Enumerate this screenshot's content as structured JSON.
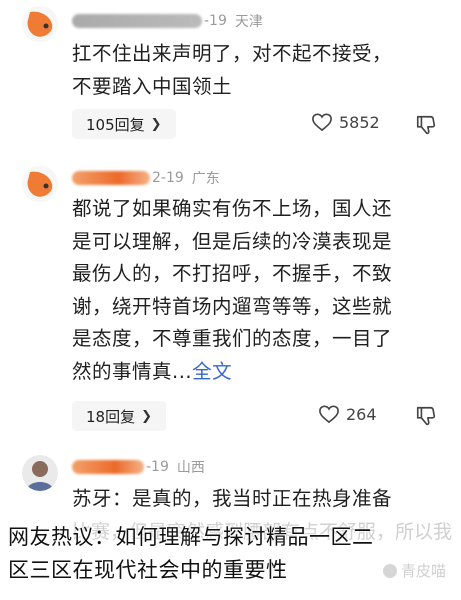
{
  "comments": [
    {
      "date_fragment": "-19",
      "location": "天津",
      "text": "扛不住出来声明了，对不起不接受，\n不要踏入中国领土",
      "reply_label": "105回复",
      "likes": "5852"
    },
    {
      "date_fragment": "2-19",
      "location": "广东",
      "text": "都说了如果确实有伤不上场，国人还\n是可以理解，但是后续的冷漠表现是\n最伤人的，不打招呼，不握手，不致\n谢，绕开特首场内遛弯等等，这些就\n是态度，不尊重我们的态度，一目了\n然的事情真...",
      "more_label": "全文",
      "reply_label": "18回复",
      "likes": "264"
    },
    {
      "date_fragment": "-19",
      "location": "山西",
      "text": "苏牙：是真的，我当时正在热身准备",
      "faded_text": "比赛，但是突然感到腰部有点不舒服，所以我也无法上场了",
      "reply_label": "",
      "likes": ""
    }
  ],
  "caption": "网友热议：如何理解与探讨精品一区二\n区三区在现代社会中的重要性",
  "watermark": "青皮喵",
  "icons": {
    "like": "heart-outline-icon",
    "dislike": "thumbs-down-icon",
    "chevron": "chevron-right-icon"
  },
  "colors": {
    "link": "#3667c9",
    "avatar_orange": "#ee7a35"
  }
}
